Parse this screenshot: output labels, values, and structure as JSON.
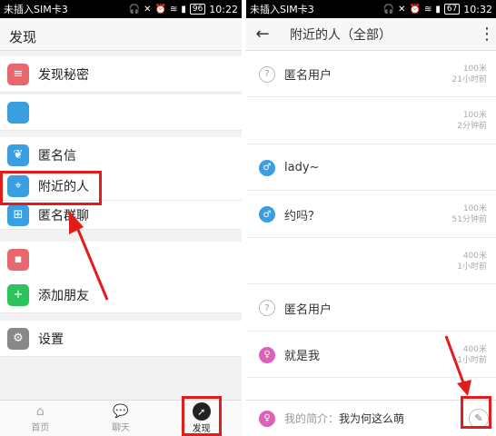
{
  "left": {
    "status": {
      "carrier": "未插入SIM卡3",
      "battery": "96",
      "time": "10:22"
    },
    "title": "发现",
    "items": [
      {
        "label": "发现秘密",
        "color": "#e8686e",
        "icon": "secret-icon"
      },
      {
        "label": "",
        "color": "#3a9fe0",
        "icon": "blank-icon"
      },
      {
        "label": "匿名信",
        "color": "#3a9fe0",
        "icon": "feather-icon"
      },
      {
        "label": "附近的人",
        "color": "#3a9fe0",
        "icon": "location-person-icon"
      },
      {
        "label": "匿名群聊",
        "color": "#3a9fe0",
        "icon": "group-chat-icon"
      },
      {
        "label": "",
        "color": "#e8686e",
        "icon": "red-icon"
      },
      {
        "label": "添加朋友",
        "color": "#2cc35c",
        "icon": "add-friend-icon"
      },
      {
        "label": "设置",
        "color": "#888888",
        "icon": "gear-icon"
      }
    ],
    "tabs": [
      {
        "label": "首页",
        "icon": "home-icon"
      },
      {
        "label": "聊天",
        "icon": "chat-icon"
      },
      {
        "label": "发现",
        "icon": "compass-icon"
      }
    ]
  },
  "right": {
    "status": {
      "carrier": "未插入SIM卡3",
      "battery": "67",
      "time": "10:32"
    },
    "title": "附近的人（全部）",
    "people": [
      {
        "name": "匿名用户",
        "type": "anon",
        "distance": "100米",
        "time": "21小时前"
      },
      {
        "name": "",
        "type": "blank",
        "distance": "100米",
        "time": "2分钟前"
      },
      {
        "name": "lady~",
        "type": "male",
        "distance": "",
        "time": ""
      },
      {
        "name": "约吗？",
        "type": "male",
        "distance": "100米",
        "time": "51分钟前"
      },
      {
        "name": "",
        "type": "blank",
        "distance": "400米",
        "time": "1小时前"
      },
      {
        "name": "匿名用户",
        "type": "anon",
        "distance": "",
        "time": ""
      },
      {
        "name": "就是我",
        "type": "female",
        "distance": "400米",
        "time": "1小时前"
      }
    ],
    "intro_label": "我的简介：",
    "intro_text": "我为何这么萌"
  },
  "colors": {
    "highlight": "#e21b1b"
  }
}
